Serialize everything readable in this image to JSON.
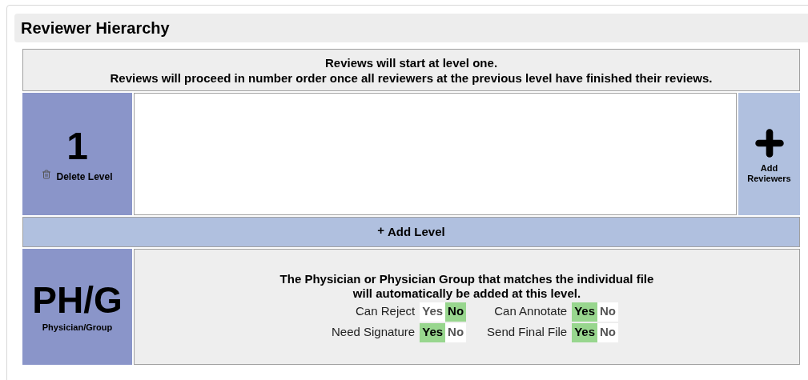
{
  "title": "Reviewer Hierarchy",
  "notice": [
    "Reviews will start at level one.",
    "Reviews will proceed in number order once all reviewers at the previous level have finished their reviews."
  ],
  "levels": [
    {
      "number": "1",
      "delete_label": "Delete Level",
      "add_reviewers_label": "Add Reviewers"
    }
  ],
  "add_level": {
    "icon": "+",
    "label": "Add Level"
  },
  "physician_level": {
    "badge": "PH/G",
    "badge_caption": "Physician/Group",
    "description": [
      "The Physician or Physician Group that matches the individual file",
      "will automatically be added at this level."
    ],
    "options": [
      {
        "label": "Can Reject",
        "choices": [
          {
            "text": "Yes",
            "selected": false
          },
          {
            "text": "No",
            "selected": true
          }
        ]
      },
      {
        "label": "Can Annotate",
        "choices": [
          {
            "text": "Yes",
            "selected": true
          },
          {
            "text": "No",
            "selected": false
          }
        ]
      },
      {
        "label": "Need Signature",
        "choices": [
          {
            "text": "Yes",
            "selected": true
          },
          {
            "text": "No",
            "selected": false
          }
        ]
      },
      {
        "label": "Send Final File",
        "choices": [
          {
            "text": "Yes",
            "selected": true
          },
          {
            "text": "No",
            "selected": false
          }
        ]
      }
    ]
  }
}
